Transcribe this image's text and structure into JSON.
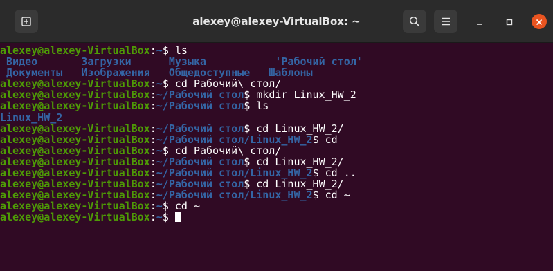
{
  "window": {
    "title": "alexey@alexey-VirtualBox: ~",
    "icons": [
      "new-tab-icon",
      "search-icon",
      "hamburger-menu-icon",
      "minimize-icon",
      "maximize-icon",
      "close-icon"
    ]
  },
  "colors": {
    "background": "#300a24",
    "prompt_user": "#4e9a06",
    "prompt_path": "#3465a4",
    "directory": "#3465a4",
    "text": "#ffffff",
    "close_button": "#e95420"
  },
  "terminal": {
    "lines": [
      [
        {
          "t": "alexey@alexey-VirtualBox",
          "c": "user"
        },
        {
          "t": ":",
          "c": "text"
        },
        {
          "t": "~",
          "c": "path"
        },
        {
          "t": "$ ls",
          "c": "text"
        }
      ],
      [
        {
          "t": " Видео       Загрузки      Музыка           'Рабочий стол'",
          "c": "dir"
        }
      ],
      [
        {
          "t": " Документы   Изображения   Общедоступные   Шаблоны",
          "c": "dir"
        }
      ],
      [
        {
          "t": "alexey@alexey-VirtualBox",
          "c": "user"
        },
        {
          "t": ":",
          "c": "text"
        },
        {
          "t": "~",
          "c": "path"
        },
        {
          "t": "$ cd Рабочий\\ стол/",
          "c": "text"
        }
      ],
      [
        {
          "t": "alexey@alexey-VirtualBox",
          "c": "user"
        },
        {
          "t": ":",
          "c": "text"
        },
        {
          "t": "~/Рабочий стол",
          "c": "path"
        },
        {
          "t": "$ mkdir Linux_HW_2",
          "c": "text"
        }
      ],
      [
        {
          "t": "alexey@alexey-VirtualBox",
          "c": "user"
        },
        {
          "t": ":",
          "c": "text"
        },
        {
          "t": "~/Рабочий стол",
          "c": "path"
        },
        {
          "t": "$ ls",
          "c": "text"
        }
      ],
      [
        {
          "t": "Linux_HW_2",
          "c": "dir"
        }
      ],
      [
        {
          "t": "alexey@alexey-VirtualBox",
          "c": "user"
        },
        {
          "t": ":",
          "c": "text"
        },
        {
          "t": "~/Рабочий стол",
          "c": "path"
        },
        {
          "t": "$ cd Linux_HW_2/",
          "c": "text"
        }
      ],
      [
        {
          "t": "alexey@alexey-VirtualBox",
          "c": "user"
        },
        {
          "t": ":",
          "c": "text"
        },
        {
          "t": "~/Рабочий стол/Linux_HW_2",
          "c": "path"
        },
        {
          "t": "$ cd",
          "c": "text"
        }
      ],
      [
        {
          "t": "alexey@alexey-VirtualBox",
          "c": "user"
        },
        {
          "t": ":",
          "c": "text"
        },
        {
          "t": "~",
          "c": "path"
        },
        {
          "t": "$ cd Рабочий\\ стол/",
          "c": "text"
        }
      ],
      [
        {
          "t": "alexey@alexey-VirtualBox",
          "c": "user"
        },
        {
          "t": ":",
          "c": "text"
        },
        {
          "t": "~/Рабочий стол",
          "c": "path"
        },
        {
          "t": "$ cd Linux_HW_2/",
          "c": "text"
        }
      ],
      [
        {
          "t": "alexey@alexey-VirtualBox",
          "c": "user"
        },
        {
          "t": ":",
          "c": "text"
        },
        {
          "t": "~/Рабочий стол/Linux_HW_2",
          "c": "path"
        },
        {
          "t": "$ cd ..",
          "c": "text"
        }
      ],
      [
        {
          "t": "alexey@alexey-VirtualBox",
          "c": "user"
        },
        {
          "t": ":",
          "c": "text"
        },
        {
          "t": "~/Рабочий стол",
          "c": "path"
        },
        {
          "t": "$ cd Linux_HW_2/",
          "c": "text"
        }
      ],
      [
        {
          "t": "alexey@alexey-VirtualBox",
          "c": "user"
        },
        {
          "t": ":",
          "c": "text"
        },
        {
          "t": "~/Рабочий стол/Linux_HW_2",
          "c": "path"
        },
        {
          "t": "$ cd ~",
          "c": "text"
        }
      ],
      [
        {
          "t": "alexey@alexey-VirtualBox",
          "c": "user"
        },
        {
          "t": ":",
          "c": "text"
        },
        {
          "t": "~",
          "c": "path"
        },
        {
          "t": "$ cd ~",
          "c": "text"
        }
      ],
      [
        {
          "t": "alexey@alexey-VirtualBox",
          "c": "user"
        },
        {
          "t": ":",
          "c": "text"
        },
        {
          "t": "~",
          "c": "path"
        },
        {
          "t": "$ ",
          "c": "text"
        }
      ]
    ]
  }
}
